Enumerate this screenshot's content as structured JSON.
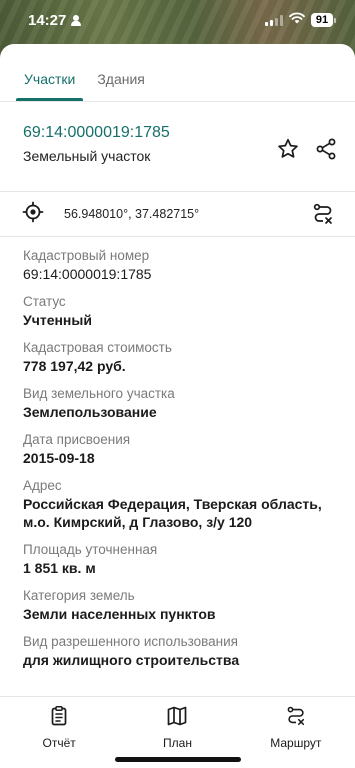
{
  "status_bar": {
    "time": "14:27",
    "battery": "91"
  },
  "tabs": [
    {
      "label": "Участки",
      "active": true
    },
    {
      "label": "Здания",
      "active": false
    }
  ],
  "header": {
    "cadastral_number": "69:14:0000019:1785",
    "subtitle": "Земельный участок"
  },
  "coordinates": "56.948010°, 37.482715°",
  "fields": [
    {
      "label": "Кадастровый номер",
      "value": "69:14:0000019:1785",
      "bold": false
    },
    {
      "label": "Статус",
      "value": "Учтенный",
      "bold": true
    },
    {
      "label": "Кадастровая стоимость",
      "value": "778 197,42 руб.",
      "bold": true
    },
    {
      "label": "Вид земельного участка",
      "value": "Землепользование",
      "bold": true
    },
    {
      "label": "Дата присвоения",
      "value": "2015-09-18",
      "bold": true
    },
    {
      "label": "Адрес",
      "value": "Российская Федерация, Тверская область, м.о. Кимрский, д Глазово, з/у 120",
      "bold": true
    },
    {
      "label": "Площадь уточненная",
      "value": "1 851 кв. м",
      "bold": true
    },
    {
      "label": "Категория земель",
      "value": "Земли населенных пунктов",
      "bold": true
    },
    {
      "label": "Вид разрешенного использования",
      "value": "для жилищного строительства",
      "bold": true
    }
  ],
  "bottom_nav": [
    {
      "label": "Отчёт",
      "icon": "clipboard-icon"
    },
    {
      "label": "План",
      "icon": "map-icon"
    },
    {
      "label": "Маршрут",
      "icon": "route-icon"
    }
  ],
  "colors": {
    "accent": "#16706a"
  }
}
